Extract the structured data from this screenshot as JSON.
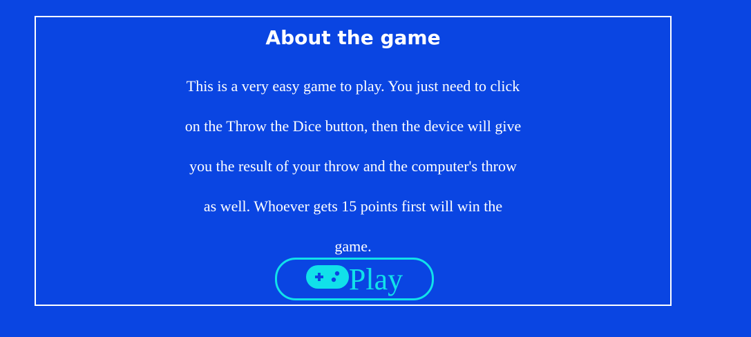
{
  "about": {
    "title": "About the game",
    "lines": [
      "This is a very easy game to play. You just need to click",
      "on the Throw the Dice button, then the device will give",
      "you the result of your throw and the computer's throw",
      "as well. Whoever gets 15 points first will win the",
      "game."
    ]
  },
  "play_button": {
    "label": "Play",
    "icon": "gamepad-icon"
  },
  "colors": {
    "background": "#0a45e2",
    "border": "#ffffff",
    "text": "#ffffff",
    "accent": "#11e1ea"
  }
}
